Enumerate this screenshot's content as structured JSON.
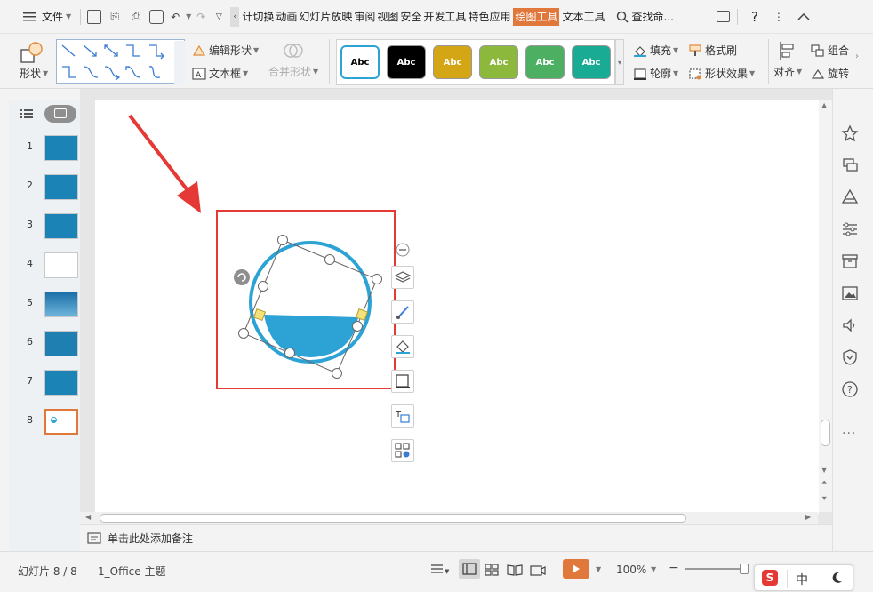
{
  "menubar": {
    "file_label": "文件",
    "tabs": [
      {
        "label": "计切换",
        "active": false
      },
      {
        "label": "动画",
        "active": false
      },
      {
        "label": "幻灯片放映",
        "active": false
      },
      {
        "label": "审阅",
        "active": false
      },
      {
        "label": "视图",
        "active": false
      },
      {
        "label": "安全",
        "active": false
      },
      {
        "label": "开发工具",
        "active": false
      },
      {
        "label": "特色应用",
        "active": false
      },
      {
        "label": "绘图工具",
        "active": true
      },
      {
        "label": "文本工具",
        "active": false
      }
    ],
    "search_label": "查找命...",
    "help_label": "?"
  },
  "ribbon": {
    "shape_label": "形状",
    "edit_shape_label": "编辑形状",
    "textbox_label": "文本框",
    "merge_shape_label": "合并形状",
    "style_sample_text": "Abc",
    "style_colors": [
      "#ffffff",
      "#000000",
      "#d4a514",
      "#8cb83c",
      "#4caf62",
      "#1aab94"
    ],
    "fill_label": "填充",
    "outline_label": "轮廓",
    "format_painter_label": "格式刷",
    "shape_effect_label": "形状效果",
    "align_label": "对齐",
    "group_label": "组合",
    "rotate_label": "旋转"
  },
  "slides": {
    "numbers": [
      "1",
      "2",
      "3",
      "4",
      "5",
      "6",
      "7",
      "8"
    ],
    "selected": "8"
  },
  "notes": {
    "placeholder": "单击此处添加备注"
  },
  "status": {
    "slide_counter": "幻灯片 8 / 8",
    "theme": "1_Office 主题",
    "zoom": "100%",
    "ime_label": "中"
  },
  "colors": {
    "accent": "#e0783c",
    "circle_blue": "#2ca3d4",
    "highlight_red": "#e53935"
  }
}
